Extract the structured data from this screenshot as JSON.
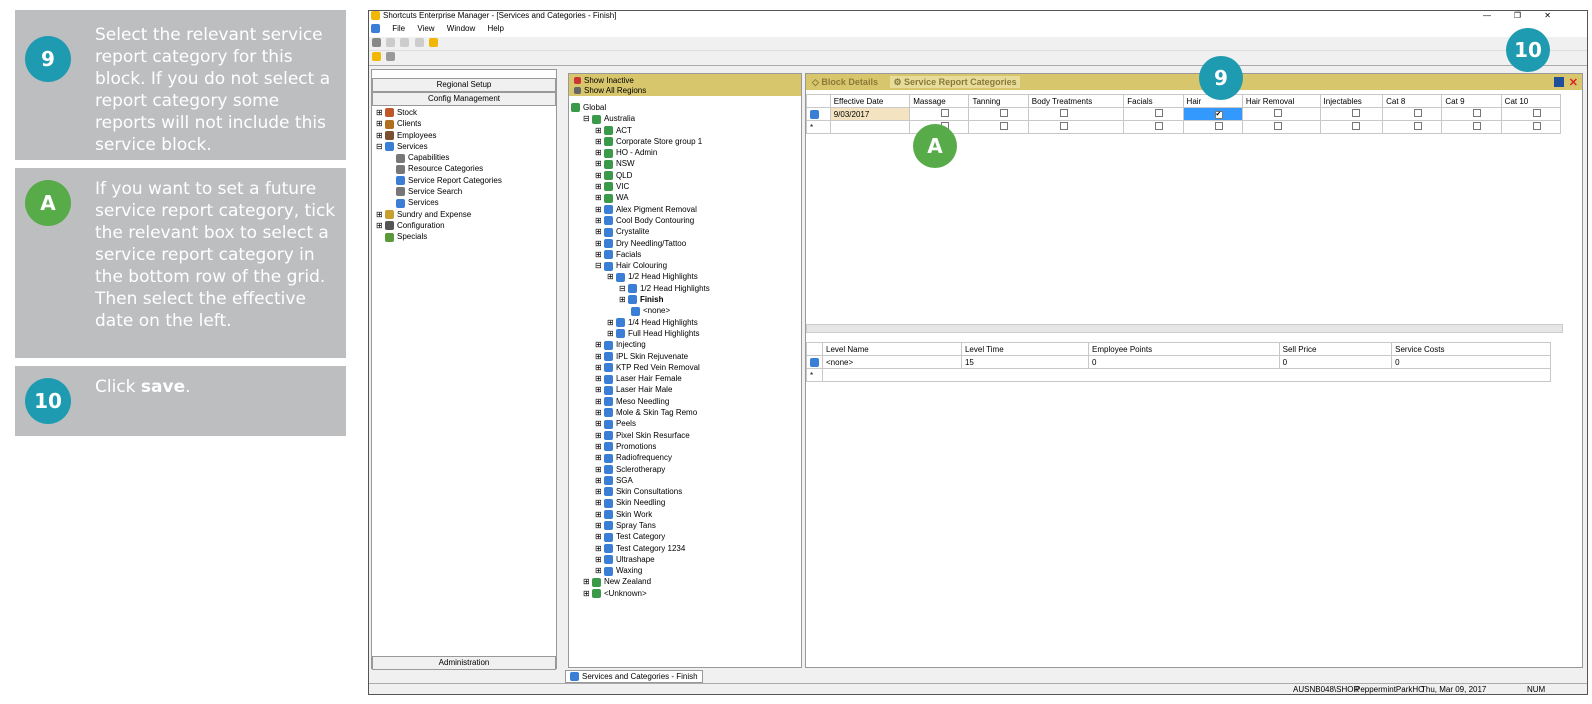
{
  "instructions": [
    {
      "number": "9",
      "text": "Select the relevant service report category for this block. If you do not select a report category some reports will not include this service block."
    },
    {
      "number": "A",
      "text": "If you want to set a future service report category, tick the relevant box to select a service report category in the bottom row of the grid. Then select the effective date on the left."
    },
    {
      "number": "10",
      "text_before": "Click ",
      "text_bold": "save",
      "text_after": "."
    }
  ],
  "window": {
    "title": "Shortcuts Enterprise Manager - [Services and Categories - Finish]"
  },
  "menu": [
    "File",
    "View",
    "Window",
    "Help"
  ],
  "left_nav": {
    "buttons": [
      "Regional Setup",
      "Config Management"
    ],
    "footer": "Administration",
    "tree": [
      "Stock",
      "Clients",
      "Employees",
      "Services",
      "Capabilities",
      "Resource Categories",
      "Service Report Categories",
      "Service Search",
      "Services",
      "Sundry and Expense",
      "Configuration",
      "Specials"
    ]
  },
  "mid": {
    "show_inactive": "Show Inactive",
    "show_all_regions": "Show All Regions",
    "tree": [
      "Global",
      "Australia",
      "ACT",
      "Corporate Store group 1",
      "HO - Admin",
      "NSW",
      "QLD",
      "VIC",
      "WA",
      "Alex Pigment Removal",
      "Cool Body Contouring",
      "Crystalite",
      "Dry Needling/Tattoo",
      "Facials",
      "Hair Colouring",
      "1/2 Head Highlights",
      "1/2 Head Highlights",
      "Finish",
      "<none>",
      "1/4 Head Highlights",
      "Full Head Highlights",
      "Injecting",
      "IPL Skin Rejuvenate",
      "KTP Red Vein Removal",
      "Laser Hair Female",
      "Laser Hair Male",
      "Meso Needling",
      "Mole & Skin Tag Remo",
      "Peels",
      "Pixel Skin Resurface",
      "Promotions",
      "Radiofrequency",
      "Sclerotherapy",
      "SGA",
      "Skin Consultations",
      "Skin Needling",
      "Skin Work",
      "Spray Tans",
      "Test Category",
      "Test Category 1234",
      "Ultrashape",
      "Waxing",
      "New Zealand",
      "<Unknown>"
    ]
  },
  "right": {
    "tab_block": "Block Details",
    "tab_report": "Service Report Categories",
    "columns": [
      "Effective Date",
      "Massage",
      "Tanning",
      "Body Treatments",
      "Facials",
      "Hair",
      "Hair Removal",
      "Injectables",
      "Cat 8",
      "Cat 9",
      "Cat 10"
    ],
    "row1_date": "9/03/2017",
    "new_row_marker": "*",
    "levels_columns": [
      "Level Name",
      "Level Time",
      "Employee Points",
      "Sell Price",
      "Service Costs"
    ],
    "levels_row": [
      "<none>",
      "15",
      "0",
      "0",
      "0"
    ]
  },
  "bottom_tab": "Services and Categories - Finish",
  "status": [
    "AUSNB048\\SHOR",
    "PeppermintParkHO",
    "Thu, Mar 09, 2017",
    "NUM"
  ],
  "callouts": {
    "nine": "9",
    "ten": "10",
    "a": "A"
  },
  "colors": {
    "teal": "#1e9bb0",
    "green": "#57ab48",
    "card": "#bcbec0",
    "panel_header": "#d8c66c"
  }
}
